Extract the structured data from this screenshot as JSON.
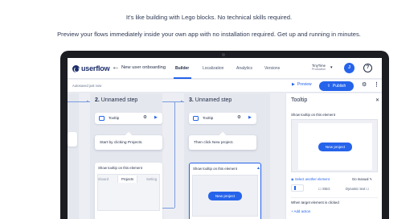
{
  "hero": {
    "line1": "It's like building with Lego blocks. No technical skills required.",
    "line2": "Preview your flows immediately inside your own app with no installation required. Get up and running in minutes."
  },
  "app": {
    "logo": "userflow",
    "flow_name": "New user onboarding",
    "tabs": [
      {
        "label": "Builder",
        "active": true
      },
      {
        "label": "Localization",
        "active": false
      },
      {
        "label": "Analytics",
        "active": false
      },
      {
        "label": "Versions",
        "active": false
      }
    ],
    "environment": {
      "name": "TinyTime",
      "sub": "Production"
    },
    "avatar_initials": "J",
    "autosaved": "Autosaved just now",
    "preview_label": "Preview",
    "publish_label": "Publish"
  },
  "canvas": {
    "steps": [
      {
        "number": "2.",
        "title": "Unnamed step",
        "element": "Tooltip",
        "bubble": "Start by clicking Projects.",
        "show_label": "Show tooltip on this element",
        "mini_tabs": [
          "nboard",
          "Projects",
          "Setting"
        ]
      },
      {
        "number": "3.",
        "title": "Unnamed step",
        "element": "Tooltip",
        "bubble": "Then click New project.",
        "show_label": "Show tooltip on this element",
        "button": "New project"
      }
    ]
  },
  "panel": {
    "title": "Tooltip",
    "show_label": "Show tooltip on this element",
    "preview_button": "New project",
    "select_element": "Select another element",
    "go_manual": "Go manual",
    "strict": "Strict",
    "dynamic_text": "Dynamic text",
    "when_label": "When target element is clicked",
    "add_action": "+ Add action"
  },
  "colors": {
    "accent": "#2563eb",
    "brand": "#1d2f6b",
    "laptop": "#1c1d22"
  }
}
